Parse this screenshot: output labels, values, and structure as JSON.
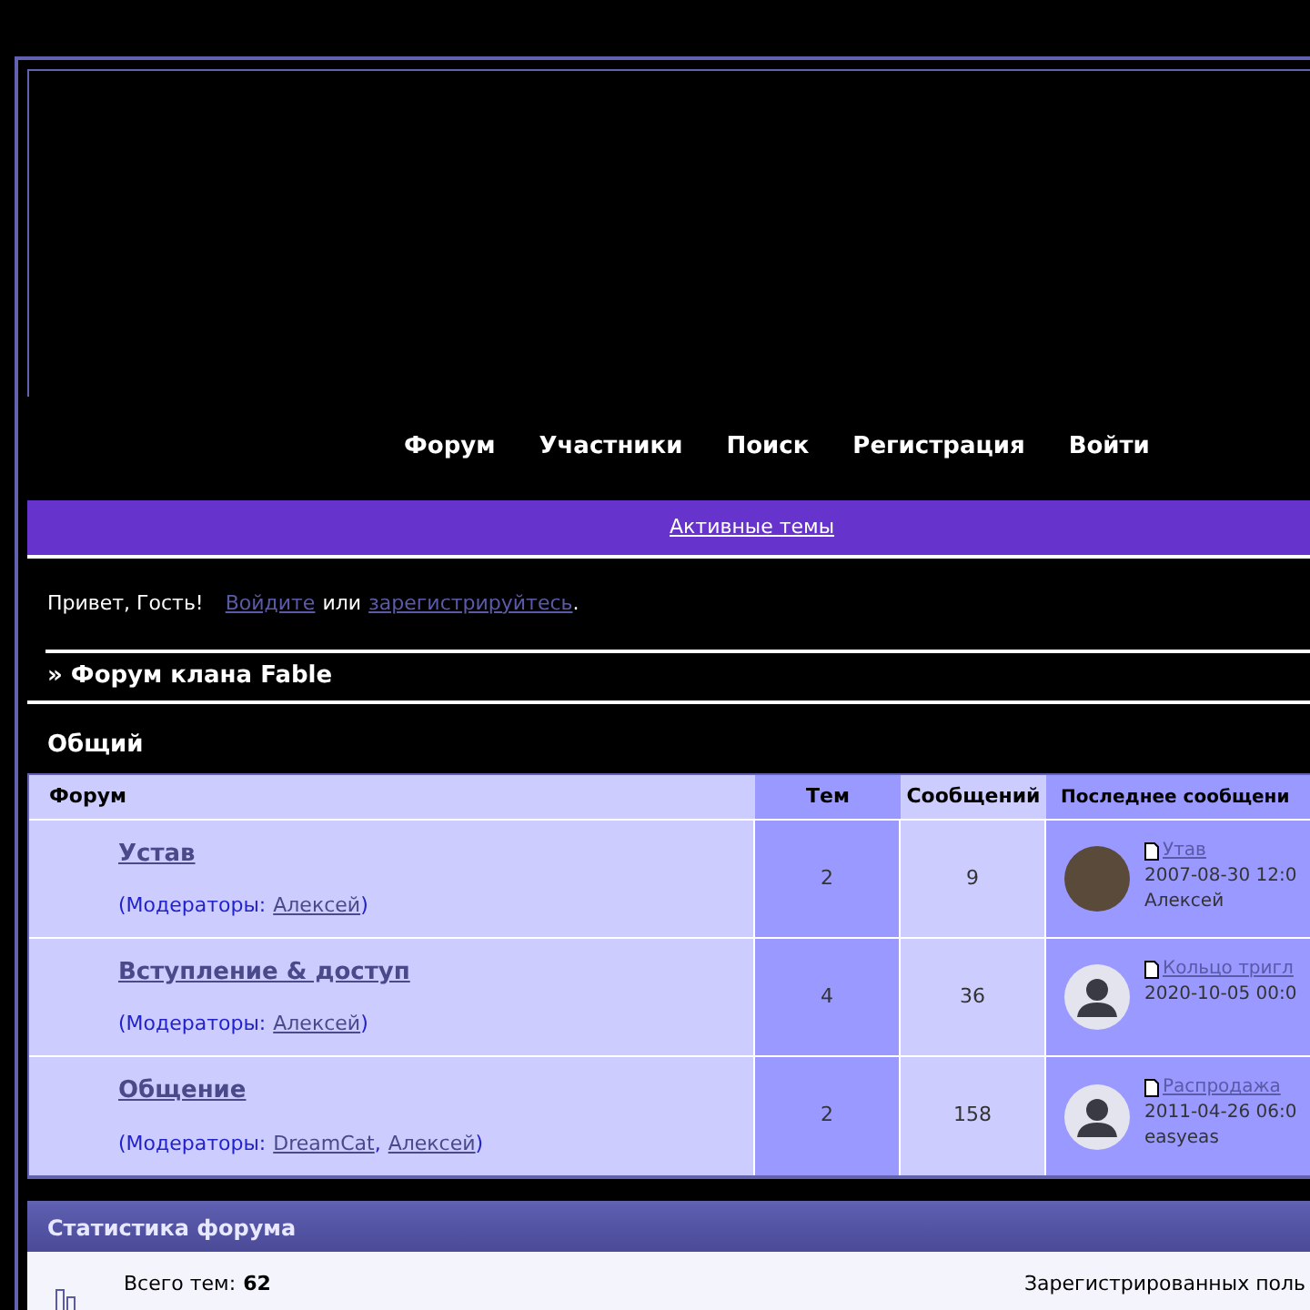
{
  "nav": [
    "Форум",
    "Участники",
    "Поиск",
    "Регистрация",
    "Войти"
  ],
  "active_topics": "Активные темы",
  "greeting": {
    "text": "Привет, Гость!",
    "login": "Войдите",
    "or": "или",
    "register": "зарегистрируйтесь",
    "end": "."
  },
  "breadcrumb": "» Форум клана Fable",
  "category": {
    "title": "Общий",
    "columns": [
      "Форум",
      "Тем",
      "Сообщений",
      "Последнее сообщени"
    ],
    "rows": [
      {
        "title": "Устав",
        "moderators_label": "(Модераторы:",
        "moderators": [
          {
            "name": "Алексей",
            "after": ")"
          }
        ],
        "topics": "2",
        "posts": "9",
        "last": {
          "kind": "photo",
          "title": "Утав",
          "date": "2007-08-30 12:0",
          "author": "Алексей"
        }
      },
      {
        "title": "Вступление & доступ",
        "moderators_label": "(Модераторы:",
        "moderators": [
          {
            "name": "Алексей",
            "after": ")"
          }
        ],
        "topics": "4",
        "posts": "36",
        "last": {
          "kind": "default",
          "title": "Кольцо тригл",
          "date": "2020-10-05 00:0"
        }
      },
      {
        "title": "Общение",
        "moderators_label": "(Модераторы:",
        "moderators": [
          {
            "name": "DreamCat",
            "after": ","
          },
          {
            "name": "Алексей",
            "after": ")"
          }
        ],
        "topics": "2",
        "posts": "158",
        "last": {
          "kind": "default",
          "title": "Распродажа",
          "date": "2011-04-26 06:0",
          "author": "easyeas"
        }
      }
    ]
  },
  "stats": {
    "title": "Статистика форума",
    "total_topics_label": "Всего тем:",
    "total_topics": "62",
    "registered": "Зарегистрированных поль"
  }
}
